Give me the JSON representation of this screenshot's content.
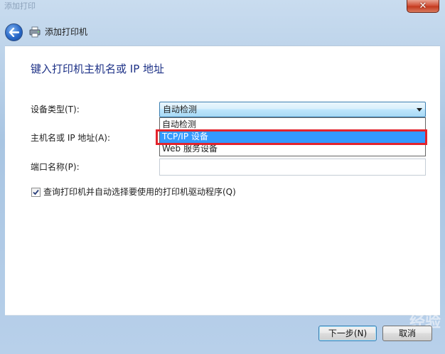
{
  "window": {
    "blurred_title": "添加打印",
    "close_glyph": "✕"
  },
  "wizard": {
    "title": "添加打印机",
    "heading": "键入打印机主机名或 IP 地址"
  },
  "form": {
    "device_type_label": "设备类型(T):",
    "device_type_value": "自动检测",
    "device_type_options": [
      "自动检测",
      "TCP/IP 设备",
      "Web 服务设备"
    ],
    "selected_option_index": 1,
    "hostname_label": "主机名或 IP 地址(A):",
    "hostname_value": "",
    "port_label": "端口名称(P):",
    "port_value": "",
    "query_checkbox_label": "查询打印机并自动选择要使用的打印机驱动程序(Q)",
    "query_checkbox_checked": true
  },
  "buttons": {
    "next": "下一步(N)",
    "cancel": "取消"
  },
  "watermark": "经验",
  "colors": {
    "heading": "#1e3287",
    "selection": "#3399ff",
    "annotation_box": "#e3232c"
  }
}
